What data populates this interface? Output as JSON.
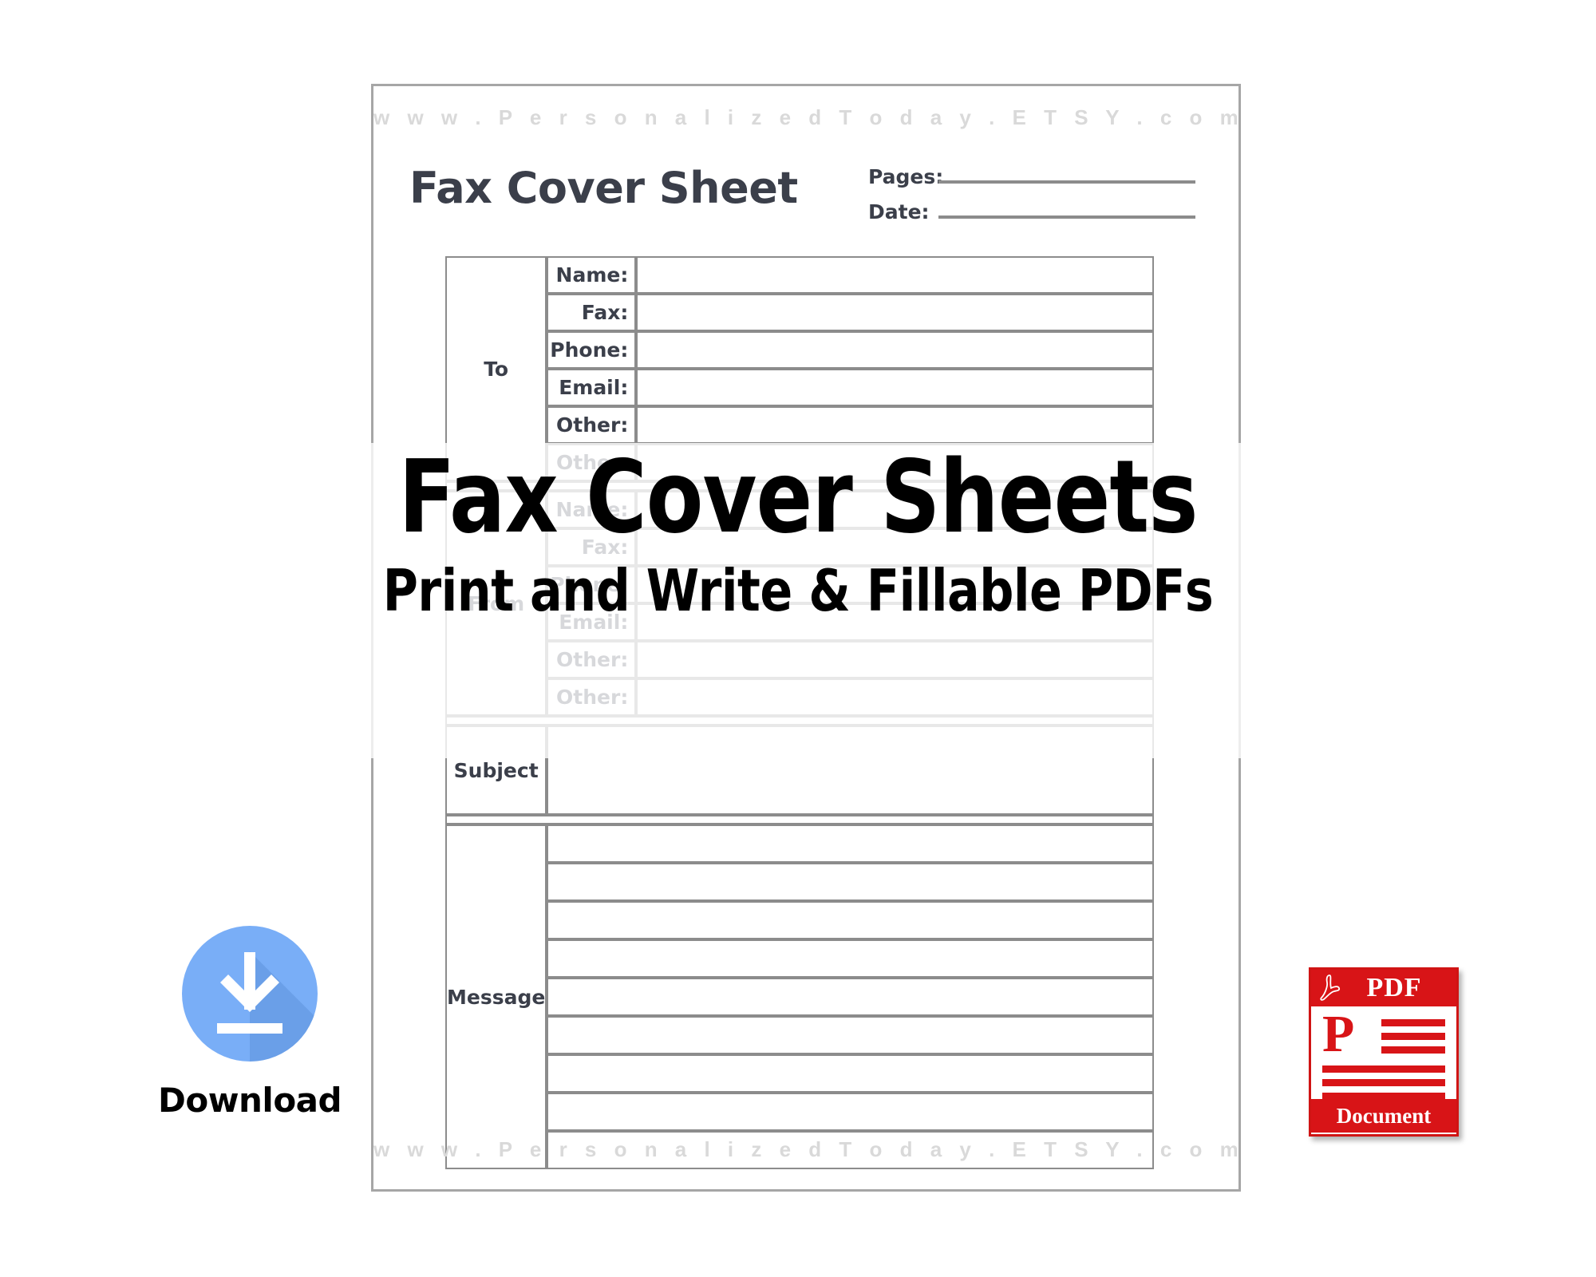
{
  "page": {
    "watermark_top": "w w w . P e r s o n a l i z e d T o d a y . E T S Y . c o m",
    "watermark_bottom": "w w w . P e r s o n a l i z e d T o d a y . E T S Y . c o m",
    "watermark_text_plain": "www.PersonalizedToday.ETSY.com",
    "title": "Fax Cover Sheet",
    "meta": [
      {
        "label": "Pages:",
        "value": ""
      },
      {
        "label": "Date:",
        "value": ""
      }
    ],
    "sections": [
      {
        "side_label": "To",
        "rows": [
          {
            "label": "Name:",
            "value": ""
          },
          {
            "label": "Fax:",
            "value": ""
          },
          {
            "label": "Phone:",
            "value": ""
          },
          {
            "label": "Email:",
            "value": ""
          },
          {
            "label": "Other:",
            "value": ""
          },
          {
            "label": "Other:",
            "value": ""
          }
        ]
      },
      {
        "side_label": "From",
        "rows": [
          {
            "label": "Name:",
            "value": ""
          },
          {
            "label": "Fax:",
            "value": ""
          },
          {
            "label": "Phone:",
            "value": ""
          },
          {
            "label": "Email:",
            "value": ""
          },
          {
            "label": "Other:",
            "value": ""
          },
          {
            "label": "Other:",
            "value": ""
          }
        ]
      }
    ],
    "subject_label": "Subject",
    "message_label": "Message",
    "message_line_count": 9
  },
  "overlay": {
    "headline": "Fax Cover Sheets",
    "subheadline": "Print and Write & Fillable PDFs"
  },
  "download": {
    "label": "Download",
    "icon": "download-arrow-icon",
    "circle_color": "#79aef7",
    "shadow_color": "#5f93dc"
  },
  "pdf_badge": {
    "header_text": "PDF",
    "letter": "P",
    "footer_text": "Document",
    "accent_color": "#d81417"
  },
  "colors": {
    "ink": "#3b3f4a",
    "rule": "#8c8c8c",
    "watermark": "#d9d9d9",
    "page_border": "#a6a6a6"
  }
}
